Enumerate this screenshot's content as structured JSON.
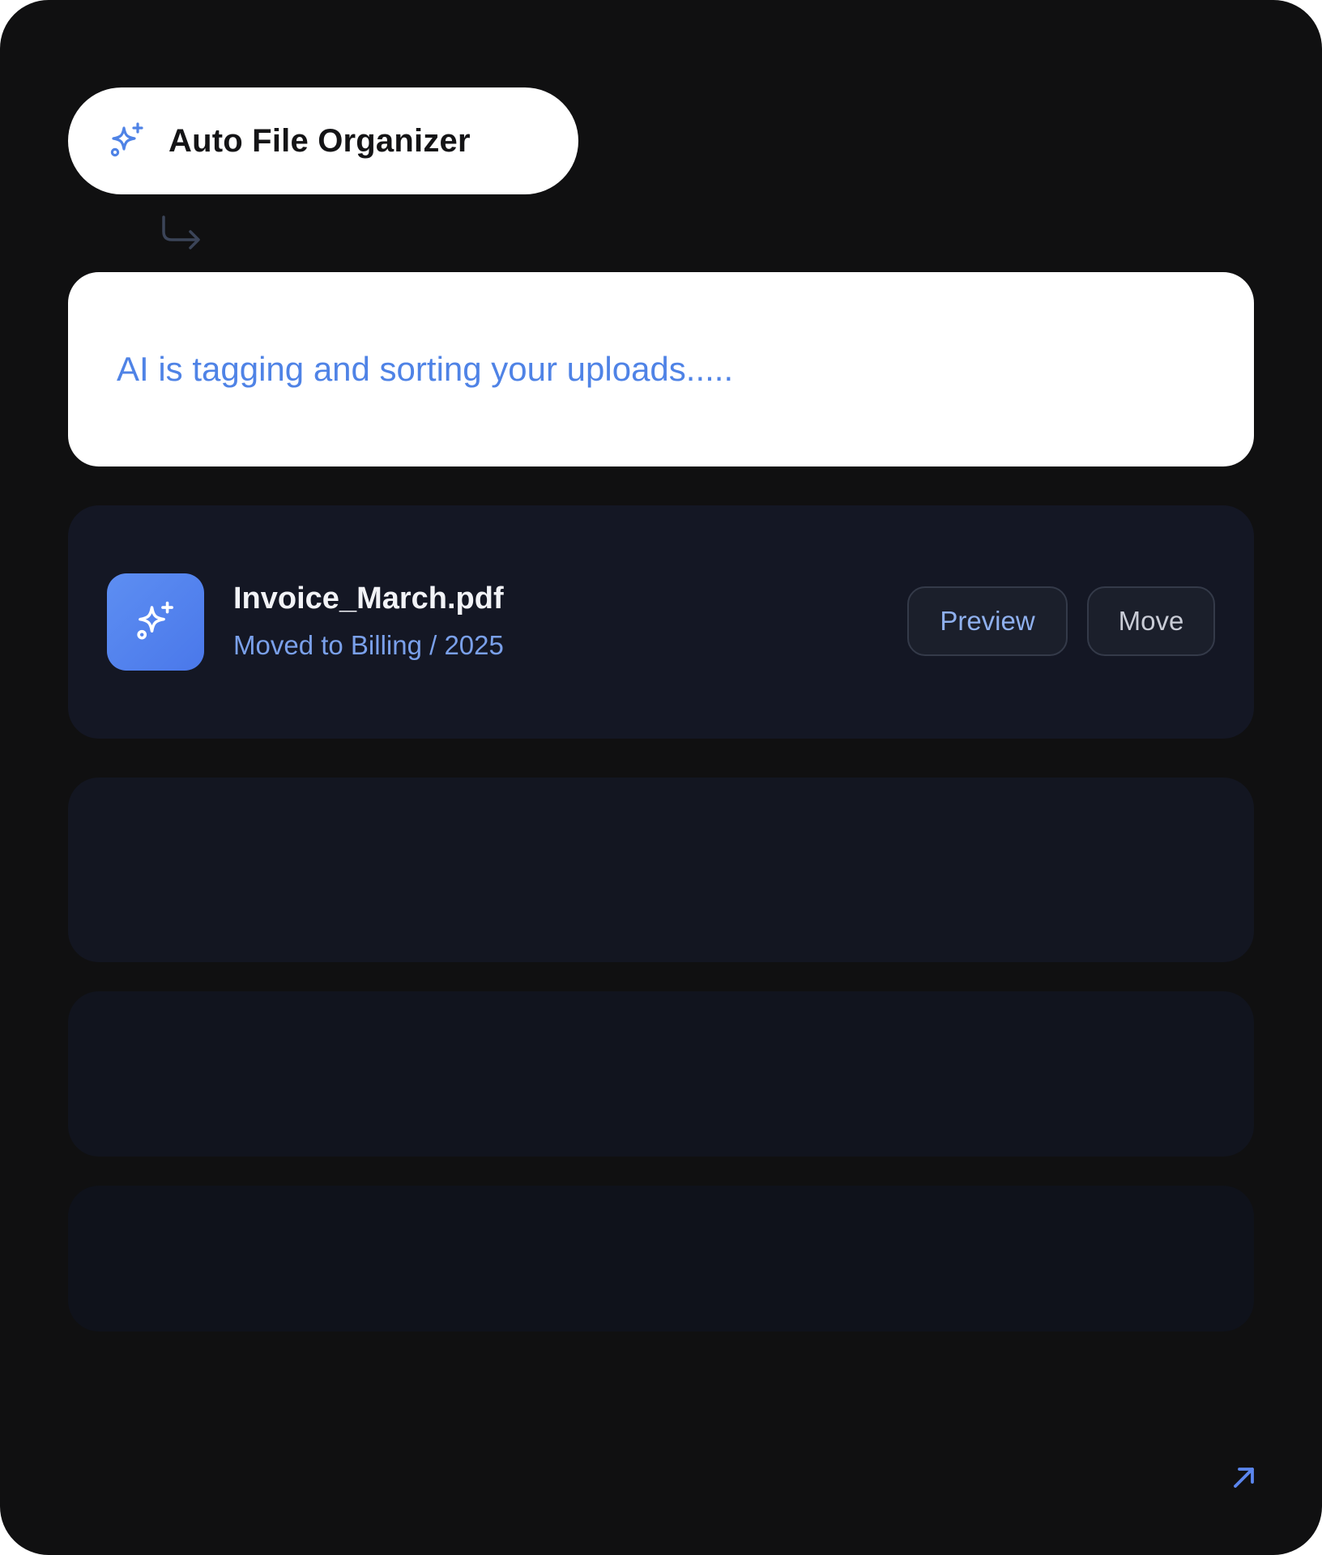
{
  "header": {
    "title": "Auto File Organizer",
    "icon": "sparkles-icon",
    "icon_color": "#4f83e6"
  },
  "status": {
    "message": "AI is tagging and sorting your uploads.....",
    "color": "#4f83e6"
  },
  "file": {
    "name": "Invoice_March.pdf",
    "status": "Moved to Billing / 2025",
    "icon": "sparkles-icon",
    "actions": {
      "preview_label": "Preview",
      "move_label": "Move"
    }
  },
  "footer": {
    "icon": "arrow-up-right-icon",
    "icon_color": "#5b86ee"
  },
  "colors": {
    "background": "#101011",
    "card": "#141724",
    "accent": "#4f83e6"
  }
}
